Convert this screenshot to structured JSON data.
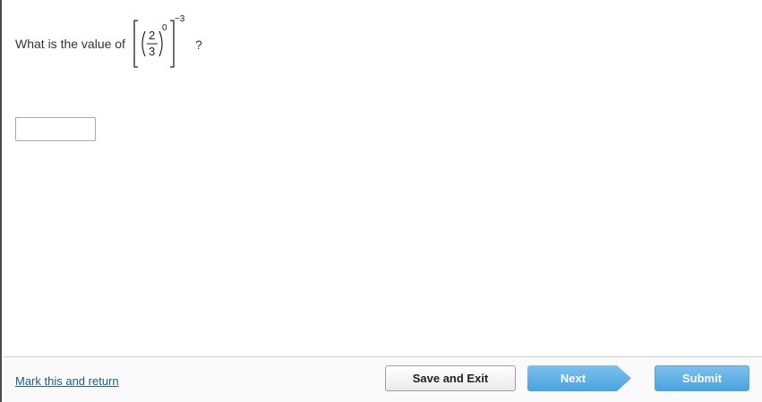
{
  "question": {
    "prefix": "What is the value of",
    "suffix": "?",
    "expression": {
      "numerator": "2",
      "denominator": "3",
      "inner_exponent": "0",
      "outer_exponent": "−3"
    }
  },
  "answer": {
    "value": ""
  },
  "footer": {
    "mark_link": "Mark this and return",
    "save_exit": "Save and Exit",
    "next": "Next",
    "submit": "Submit"
  },
  "colors": {
    "primary_button": "#5fb0e6",
    "link": "#1a5c8a"
  }
}
